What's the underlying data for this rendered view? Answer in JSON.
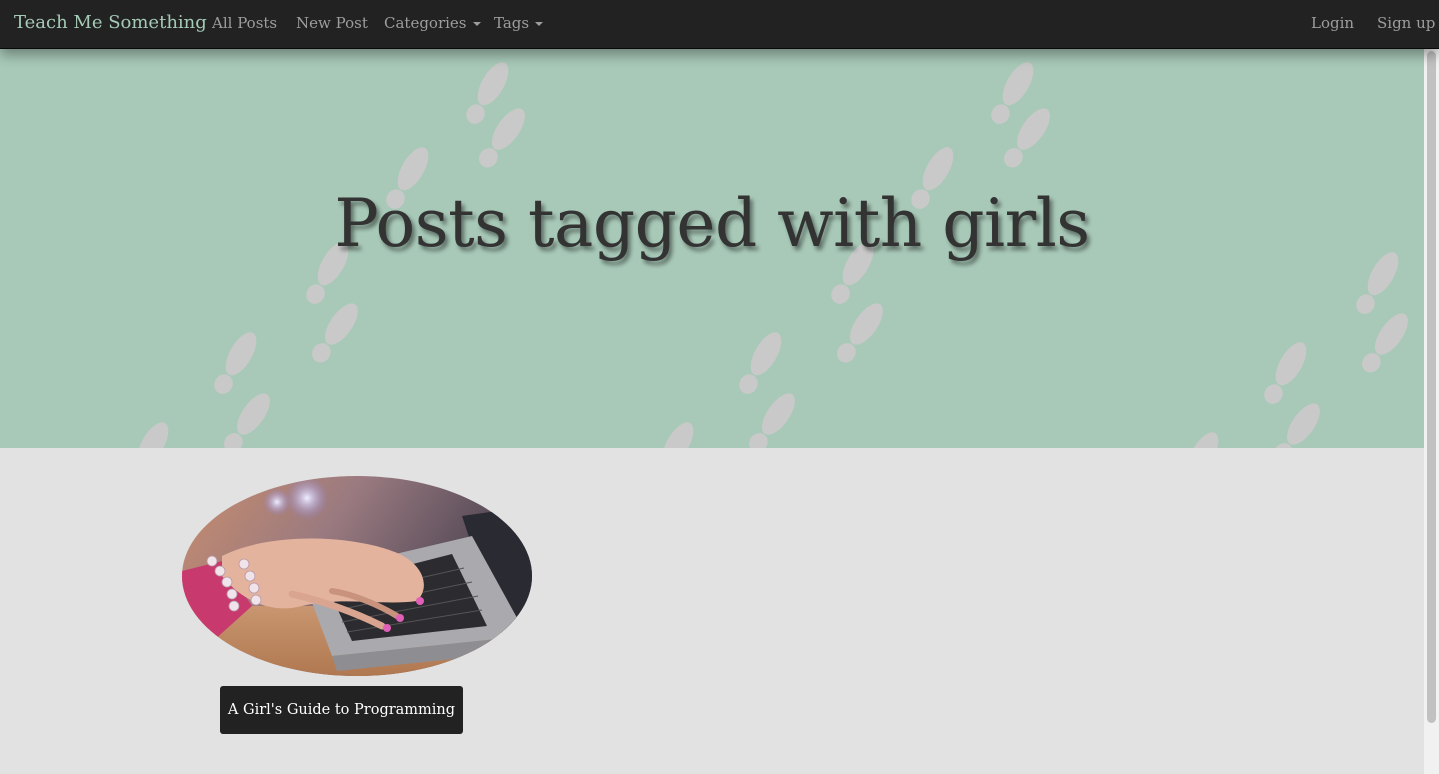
{
  "navbar": {
    "brand": "Teach Me Something",
    "links": [
      "All Posts",
      "New Post"
    ],
    "dropdowns": [
      "Categories",
      "Tags"
    ],
    "right_links": [
      "Login",
      "Sign up"
    ]
  },
  "hero": {
    "title": "Posts tagged with girls",
    "background_color": "#a8c9b8",
    "pattern_icon": "footprints-icon"
  },
  "posts": [
    {
      "title": "A Girl's Guide to Programming",
      "image_icon": "laptop-typing-photo"
    }
  ],
  "colors": {
    "navbar_bg": "#222222",
    "brand": "#a5cbb7",
    "page_bg": "#e2e2e2",
    "button_bg": "#222222"
  }
}
